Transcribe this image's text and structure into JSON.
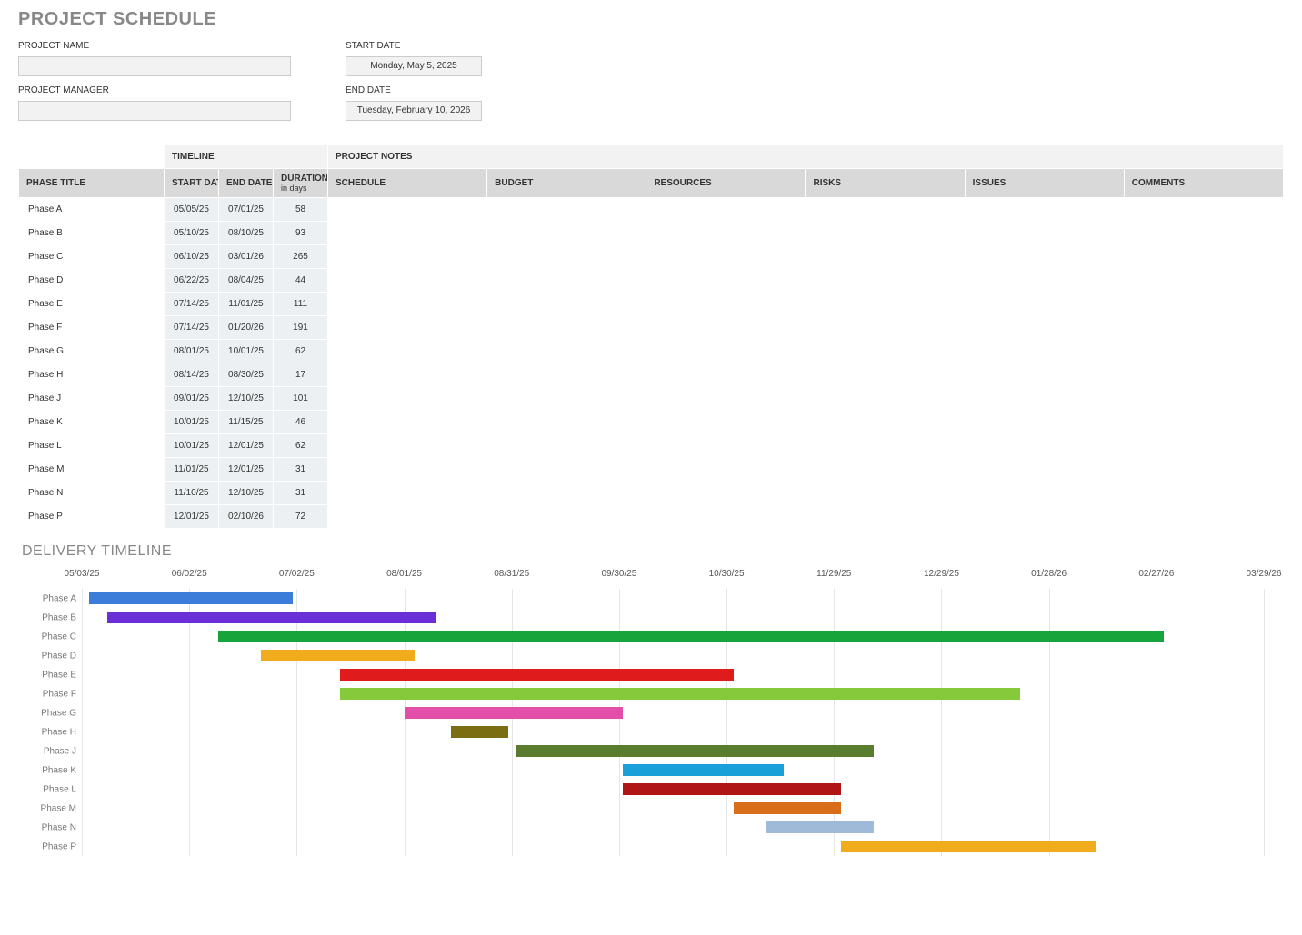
{
  "title": "PROJECT SCHEDULE",
  "meta": {
    "project_name_label": "PROJECT NAME",
    "project_name_value": "",
    "project_manager_label": "PROJECT MANAGER",
    "project_manager_value": "",
    "start_date_label": "START DATE",
    "start_date_value": "Monday, May 5, 2025",
    "end_date_label": "END DATE",
    "end_date_value": "Tuesday, February 10, 2026"
  },
  "table": {
    "group_timeline": "TIMELINE",
    "group_notes": "PROJECT NOTES",
    "headers": {
      "phase_title": "PHASE TITLE",
      "start_date": "START DATE",
      "end_date": "END DATE",
      "duration": "DURATION",
      "duration_sub": "in days",
      "schedule": "SCHEDULE",
      "budget": "BUDGET",
      "resources": "RESOURCES",
      "risks": "RISKS",
      "issues": "ISSUES",
      "comments": "COMMENTS"
    },
    "rows": [
      {
        "phase": "Phase A",
        "start": "05/05/25",
        "end": "07/01/25",
        "dur": "58",
        "schedule": "",
        "budget": "",
        "resources": "",
        "risks": "",
        "issues": "",
        "comments": ""
      },
      {
        "phase": "Phase B",
        "start": "05/10/25",
        "end": "08/10/25",
        "dur": "93",
        "schedule": "",
        "budget": "",
        "resources": "",
        "risks": "",
        "issues": "",
        "comments": ""
      },
      {
        "phase": "Phase C",
        "start": "06/10/25",
        "end": "03/01/26",
        "dur": "265",
        "schedule": "",
        "budget": "",
        "resources": "",
        "risks": "",
        "issues": "",
        "comments": ""
      },
      {
        "phase": "Phase D",
        "start": "06/22/25",
        "end": "08/04/25",
        "dur": "44",
        "schedule": "",
        "budget": "",
        "resources": "",
        "risks": "",
        "issues": "",
        "comments": ""
      },
      {
        "phase": "Phase E",
        "start": "07/14/25",
        "end": "11/01/25",
        "dur": "111",
        "schedule": "",
        "budget": "",
        "resources": "",
        "risks": "",
        "issues": "",
        "comments": ""
      },
      {
        "phase": "Phase F",
        "start": "07/14/25",
        "end": "01/20/26",
        "dur": "191",
        "schedule": "",
        "budget": "",
        "resources": "",
        "risks": "",
        "issues": "",
        "comments": ""
      },
      {
        "phase": "Phase G",
        "start": "08/01/25",
        "end": "10/01/25",
        "dur": "62",
        "schedule": "",
        "budget": "",
        "resources": "",
        "risks": "",
        "issues": "",
        "comments": ""
      },
      {
        "phase": "Phase H",
        "start": "08/14/25",
        "end": "08/30/25",
        "dur": "17",
        "schedule": "",
        "budget": "",
        "resources": "",
        "risks": "",
        "issues": "",
        "comments": ""
      },
      {
        "phase": "Phase J",
        "start": "09/01/25",
        "end": "12/10/25",
        "dur": "101",
        "schedule": "",
        "budget": "",
        "resources": "",
        "risks": "",
        "issues": "",
        "comments": ""
      },
      {
        "phase": "Phase K",
        "start": "10/01/25",
        "end": "11/15/25",
        "dur": "46",
        "schedule": "",
        "budget": "",
        "resources": "",
        "risks": "",
        "issues": "",
        "comments": ""
      },
      {
        "phase": "Phase L",
        "start": "10/01/25",
        "end": "12/01/25",
        "dur": "62",
        "schedule": "",
        "budget": "",
        "resources": "",
        "risks": "",
        "issues": "",
        "comments": ""
      },
      {
        "phase": "Phase M",
        "start": "11/01/25",
        "end": "12/01/25",
        "dur": "31",
        "schedule": "",
        "budget": "",
        "resources": "",
        "risks": "",
        "issues": "",
        "comments": ""
      },
      {
        "phase": "Phase N",
        "start": "11/10/25",
        "end": "12/10/25",
        "dur": "31",
        "schedule": "",
        "budget": "",
        "resources": "",
        "risks": "",
        "issues": "",
        "comments": ""
      },
      {
        "phase": "Phase P",
        "start": "12/01/25",
        "end": "02/10/26",
        "dur": "72",
        "schedule": "",
        "budget": "",
        "resources": "",
        "risks": "",
        "issues": "",
        "comments": ""
      }
    ]
  },
  "timeline_title": "DELIVERY TIMELINE",
  "chart_data": {
    "type": "bar",
    "orientation": "horizontal-gantt",
    "x_start": "05/03/25",
    "x_end": "03/29/26",
    "x_ticks": [
      "05/03/25",
      "06/02/25",
      "07/02/25",
      "08/01/25",
      "08/31/25",
      "09/30/25",
      "10/30/25",
      "11/29/25",
      "12/29/25",
      "01/28/26",
      "02/27/26",
      "03/29/26"
    ],
    "series": [
      {
        "name": "Phase A",
        "start": "05/05/25",
        "end": "07/01/25",
        "color": "#3b7dd8"
      },
      {
        "name": "Phase B",
        "start": "05/10/25",
        "end": "08/10/25",
        "color": "#6a2fd6"
      },
      {
        "name": "Phase C",
        "start": "06/10/25",
        "end": "03/01/26",
        "color": "#17a43b"
      },
      {
        "name": "Phase D",
        "start": "06/22/25",
        "end": "08/04/25",
        "color": "#f0ac1c"
      },
      {
        "name": "Phase E",
        "start": "07/14/25",
        "end": "11/01/25",
        "color": "#e01b1b"
      },
      {
        "name": "Phase F",
        "start": "07/14/25",
        "end": "01/20/26",
        "color": "#86c93b"
      },
      {
        "name": "Phase G",
        "start": "08/01/25",
        "end": "10/01/25",
        "color": "#e34fa8"
      },
      {
        "name": "Phase H",
        "start": "08/14/25",
        "end": "08/30/25",
        "color": "#7a6e12"
      },
      {
        "name": "Phase J",
        "start": "09/01/25",
        "end": "12/10/25",
        "color": "#5a7c2e"
      },
      {
        "name": "Phase K",
        "start": "10/01/25",
        "end": "11/15/25",
        "color": "#1aa0d8"
      },
      {
        "name": "Phase L",
        "start": "10/01/25",
        "end": "12/01/25",
        "color": "#b01616"
      },
      {
        "name": "Phase M",
        "start": "11/01/25",
        "end": "12/01/25",
        "color": "#d86d1a"
      },
      {
        "name": "Phase N",
        "start": "11/10/25",
        "end": "12/10/25",
        "color": "#9fb9d8"
      },
      {
        "name": "Phase P",
        "start": "12/01/25",
        "end": "02/10/26",
        "color": "#f0ac1c"
      }
    ]
  }
}
